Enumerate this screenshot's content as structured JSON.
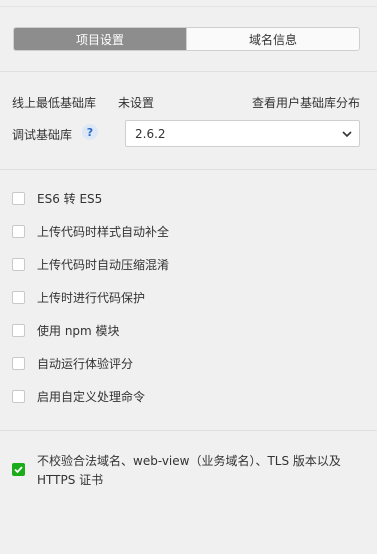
{
  "tabs": [
    {
      "label": "项目设置",
      "active": true
    },
    {
      "label": "域名信息",
      "active": false
    }
  ],
  "base_lib": {
    "online_min_label": "线上最低基础库",
    "online_min_value": "未设置",
    "view_distribution_link": "查看用户基础库分布",
    "debug_label": "调试基础库",
    "help_icon": "?",
    "debug_value": "2.6.2"
  },
  "options": [
    {
      "label": "ES6 转 ES5",
      "checked": false
    },
    {
      "label": "上传代码时样式自动补全",
      "checked": false
    },
    {
      "label": "上传代码时自动压缩混淆",
      "checked": false
    },
    {
      "label": "上传时进行代码保护",
      "checked": false
    },
    {
      "label": "使用 npm 模块",
      "checked": false
    },
    {
      "label": "自动运行体验评分",
      "checked": false
    },
    {
      "label": "启用自定义处理命令",
      "checked": false
    }
  ],
  "domain_check": {
    "label": "不校验合法域名、web-view（业务域名）、TLS 版本以及 HTTPS 证书",
    "checked": true
  },
  "colors": {
    "checked": "#1aad19",
    "active_tab": "#8d8d8d"
  }
}
